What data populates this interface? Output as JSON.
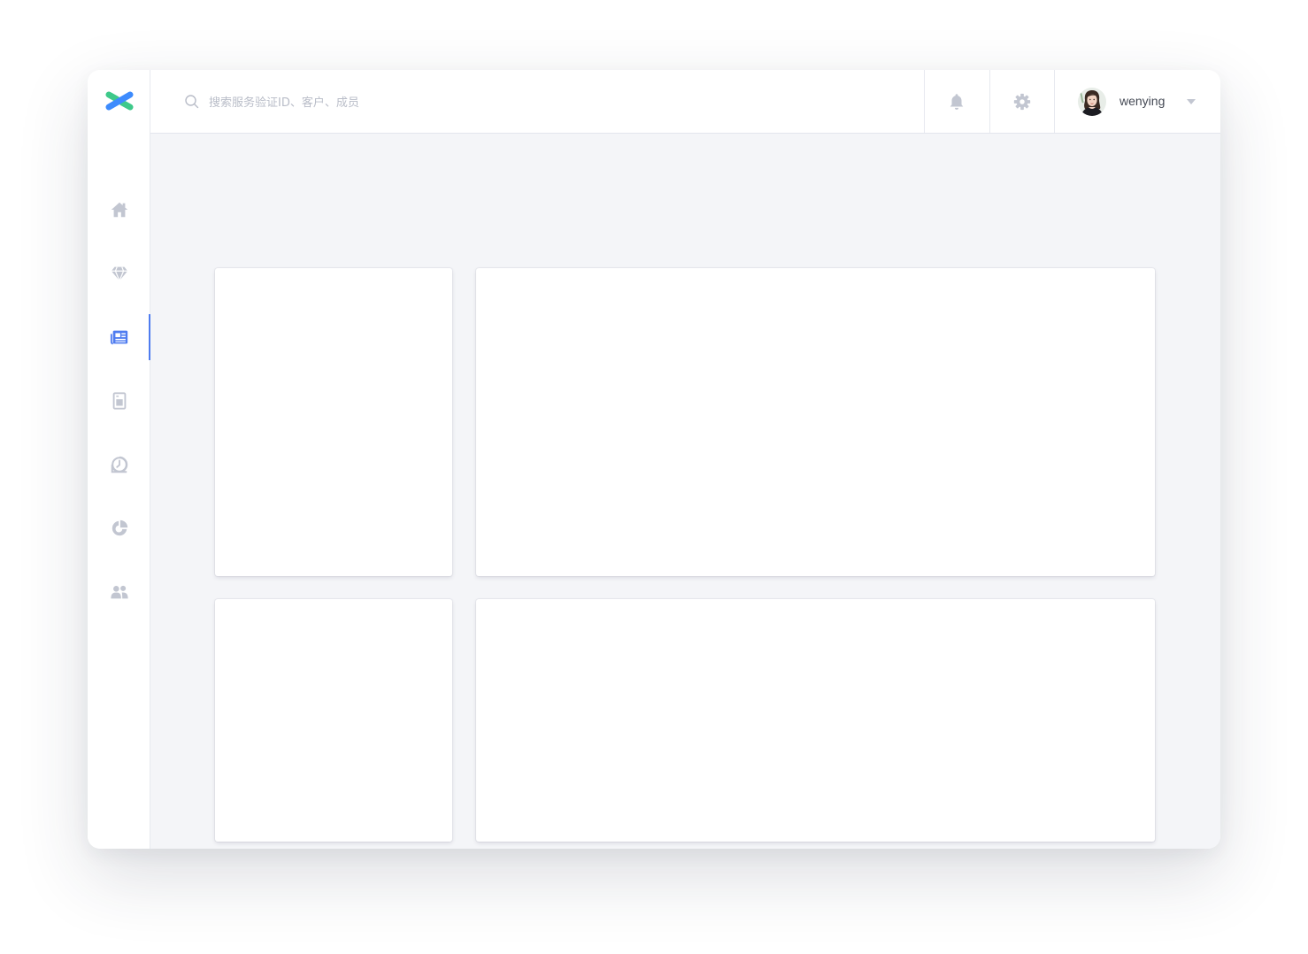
{
  "colors": {
    "accent": "#4f7cf0",
    "icon_inactive": "#c2c6d1",
    "content_bg": "#f4f5f8",
    "logo_blue": "#3d8bfd",
    "logo_green": "#3ec98a"
  },
  "app": {
    "logo": "x-logo"
  },
  "sidebar": {
    "items": [
      {
        "name": "home",
        "icon": "home-icon",
        "active": false
      },
      {
        "name": "diamond",
        "icon": "diamond-icon",
        "active": false
      },
      {
        "name": "news",
        "icon": "newspaper-icon",
        "active": true
      },
      {
        "name": "document",
        "icon": "document-icon",
        "active": false
      },
      {
        "name": "clock",
        "icon": "clock-icon",
        "active": false
      },
      {
        "name": "pie-chart",
        "icon": "pie-chart-icon",
        "active": false
      },
      {
        "name": "users",
        "icon": "users-icon",
        "active": false
      }
    ]
  },
  "header": {
    "search": {
      "placeholder": "搜索服务验证ID、客户、成员",
      "value": "",
      "icon": "search-icon"
    },
    "notifications": {
      "icon": "bell-icon"
    },
    "settings": {
      "icon": "gear-icon"
    },
    "user": {
      "name": "wenying",
      "icon": "chevron-down-icon"
    }
  },
  "main": {
    "cards": [
      {
        "name": "card-top-left"
      },
      {
        "name": "card-top-right"
      },
      {
        "name": "card-bottom-left"
      },
      {
        "name": "card-bottom-right"
      }
    ]
  }
}
